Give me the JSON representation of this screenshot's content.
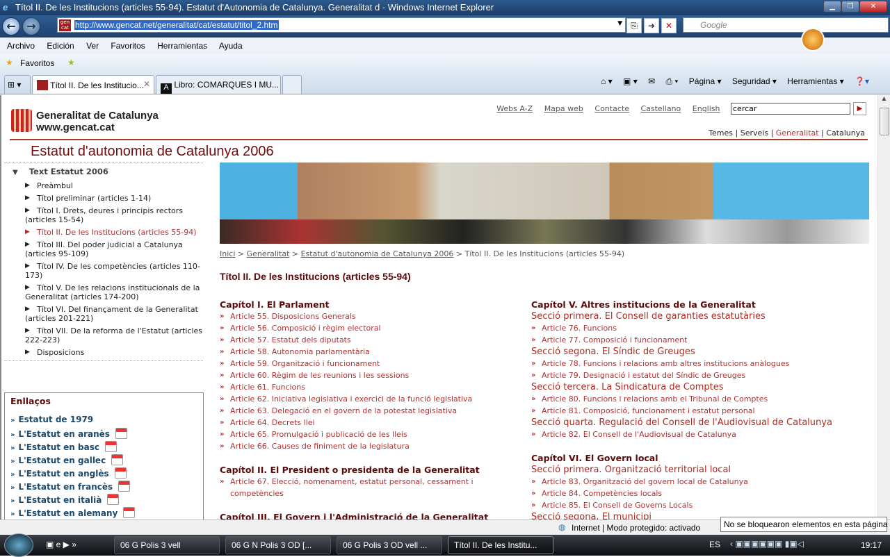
{
  "window": {
    "title": "Títol II. De les Institucions (articles 55-94). Estatut d'Autonomia de Catalunya. Generalitat d - Windows Internet Explorer"
  },
  "address": {
    "url": "http://www.gencat.net/generalitat/cat/estatut/titol_2.htm",
    "favicon": "gen cat",
    "search_placeholder": "Google"
  },
  "menu": [
    "Archivo",
    "Edición",
    "Ver",
    "Favoritos",
    "Herramientas",
    "Ayuda"
  ],
  "favorites": {
    "label": "Favoritos"
  },
  "tabs": [
    {
      "label": "Títol II. De les Institucio...",
      "active": true
    },
    {
      "label": "Libro: COMARQUES I MU...",
      "active": false
    }
  ],
  "commandbar": {
    "page": "Página ▾",
    "security": "Seguridad ▾",
    "tools": "Herramientas ▾"
  },
  "site": {
    "logo_name": "Generalitat de Catalunya",
    "logo_url": "www.gencat.cat",
    "top_links": [
      "Webs A-Z",
      "Mapa web",
      "Contacte",
      "Castellano",
      "English"
    ],
    "search_value": "cercar",
    "nav": [
      "Temes",
      "Serveis",
      "Generalitat",
      "Catalunya"
    ],
    "page_heading": "Estatut d'autonomia de Catalunya 2006",
    "accent": "#a33a2a"
  },
  "sidebar": {
    "root": "Text Estatut 2006",
    "items": [
      "Preàmbul",
      "Títol preliminar (articles 1-14)",
      "Títol I. Drets, deures i principis rectors (articles 15-54)",
      "Títol II. De les Institucions (articles 55-94)",
      "Títol III. Del poder judicial a Catalunya (articles 95-109)",
      "Títol IV. De les competències (articles 110-173)",
      "Títol V. De les relacions institucionals de la Generalitat (articles 174-200)",
      "Títol VI. Del finançament de la Generalitat (articles 201-221)",
      "Títol VII. De la reforma de l'Estatut (articles 222-223)",
      "Disposicions"
    ],
    "current_index": 3
  },
  "links": {
    "title": "Enllaços",
    "items": [
      {
        "label": "Estatut de 1979",
        "pdf": false
      },
      {
        "label": "L'Estatut en aranès",
        "pdf": true
      },
      {
        "label": "L'Estatut en basc",
        "pdf": true
      },
      {
        "label": "L'Estatut en gallec",
        "pdf": true
      },
      {
        "label": "L'Estatut en anglès",
        "pdf": true
      },
      {
        "label": "L'Estatut en francès",
        "pdf": true
      },
      {
        "label": "L'Estatut en italià",
        "pdf": true
      },
      {
        "label": "L'Estatut en alemany",
        "pdf": true
      }
    ]
  },
  "breadcrumb": {
    "items": [
      "Inici",
      "Generalitat",
      "Estatut d'autonomia de Catalunya 2006"
    ],
    "current": "Títol II. De les Institucions (articles 55-94)",
    "sep": ">"
  },
  "main": {
    "title": "Títol II. De les Institucions (articles 55-94)",
    "left": [
      {
        "t": "cap",
        "v": "Capítol I. El Parlament"
      },
      {
        "t": "art",
        "v": "Article 55. Disposicions Generals"
      },
      {
        "t": "art",
        "v": "Article 56. Composició i règim electoral"
      },
      {
        "t": "art",
        "v": "Article 57. Estatut dels diputats"
      },
      {
        "t": "art",
        "v": "Article 58. Autonomia parlamentària"
      },
      {
        "t": "art",
        "v": "Article 59. Organització i funcionament"
      },
      {
        "t": "art",
        "v": "Article 60. Règim de les reunions i les sessions"
      },
      {
        "t": "art",
        "v": "Article 61. Funcions"
      },
      {
        "t": "art",
        "v": "Article 62. Iniciativa legislativa i exercici de la funció legislativa"
      },
      {
        "t": "art",
        "v": "Article 63. Delegació en el govern de la potestat legislativa"
      },
      {
        "t": "art",
        "v": "Article 64. Decrets llei"
      },
      {
        "t": "art",
        "v": "Article 65. Promulgació i publicació de les lleis"
      },
      {
        "t": "art",
        "v": "Article 66. Causes de finiment de la legislatura"
      },
      {
        "t": "gap",
        "v": ""
      },
      {
        "t": "cap",
        "v": "Capítol II. El President o presidenta de la Generalitat"
      },
      {
        "t": "art",
        "v": "Article 67. Elecció, nomenament, estatut personal, cessament i competències"
      },
      {
        "t": "gap",
        "v": ""
      },
      {
        "t": "cap",
        "v": "Capítol III. El Govern i l'Administració de la Generalitat"
      }
    ],
    "right": [
      {
        "t": "cap",
        "v": "Capítol V. Altres institucions de la Generalitat"
      },
      {
        "t": "sec",
        "v": "Secció primera. El Consell de garanties estatutàries"
      },
      {
        "t": "art",
        "v": "Article 76. Funcions"
      },
      {
        "t": "art",
        "v": "Article 77. Composició i funcionament"
      },
      {
        "t": "sec",
        "v": "Secció segona. El Síndic de Greuges"
      },
      {
        "t": "art",
        "v": "Article 78. Funcions i relacions amb altres institucions anàlogues"
      },
      {
        "t": "art",
        "v": "Article 79. Designació i estatut del Síndic de Greuges"
      },
      {
        "t": "sec",
        "v": "Secció tercera. La Sindicatura de Comptes"
      },
      {
        "t": "art",
        "v": "Article 80. Funcions i relacions amb el Tribunal de Comptes"
      },
      {
        "t": "art",
        "v": "Article 81. Composició, funcionament i estatut personal"
      },
      {
        "t": "sec",
        "v": "Secció quarta. Regulació del Consell de l'Audiovisual de Catalunya"
      },
      {
        "t": "art",
        "v": "Article 82. El Consell de l'Audiovisual de Catalunya"
      },
      {
        "t": "gap",
        "v": ""
      },
      {
        "t": "cap",
        "v": "Capítol VI. El Govern local"
      },
      {
        "t": "sec",
        "v": "Secció primera. Organització territorial local"
      },
      {
        "t": "art",
        "v": "Article 83. Organització del govern local de Catalunya"
      },
      {
        "t": "art",
        "v": "Article 84. Competències locals"
      },
      {
        "t": "art",
        "v": "Article 85. El Consell de Governs Locals"
      },
      {
        "t": "sec",
        "v": "Secció segona. El municipi"
      }
    ]
  },
  "status": {
    "zone": "Internet | Modo protegido: activado",
    "tooltip": "No se bloquearon elementos en esta página"
  },
  "taskbar": {
    "tasks": [
      "06 G Polis 3 vell",
      "06 G N Polis 3 OD [...",
      "06 G Polis 3 OD vell ...",
      "Títol II. De les Institu..."
    ],
    "lang": "ES",
    "clock": "19:17"
  }
}
